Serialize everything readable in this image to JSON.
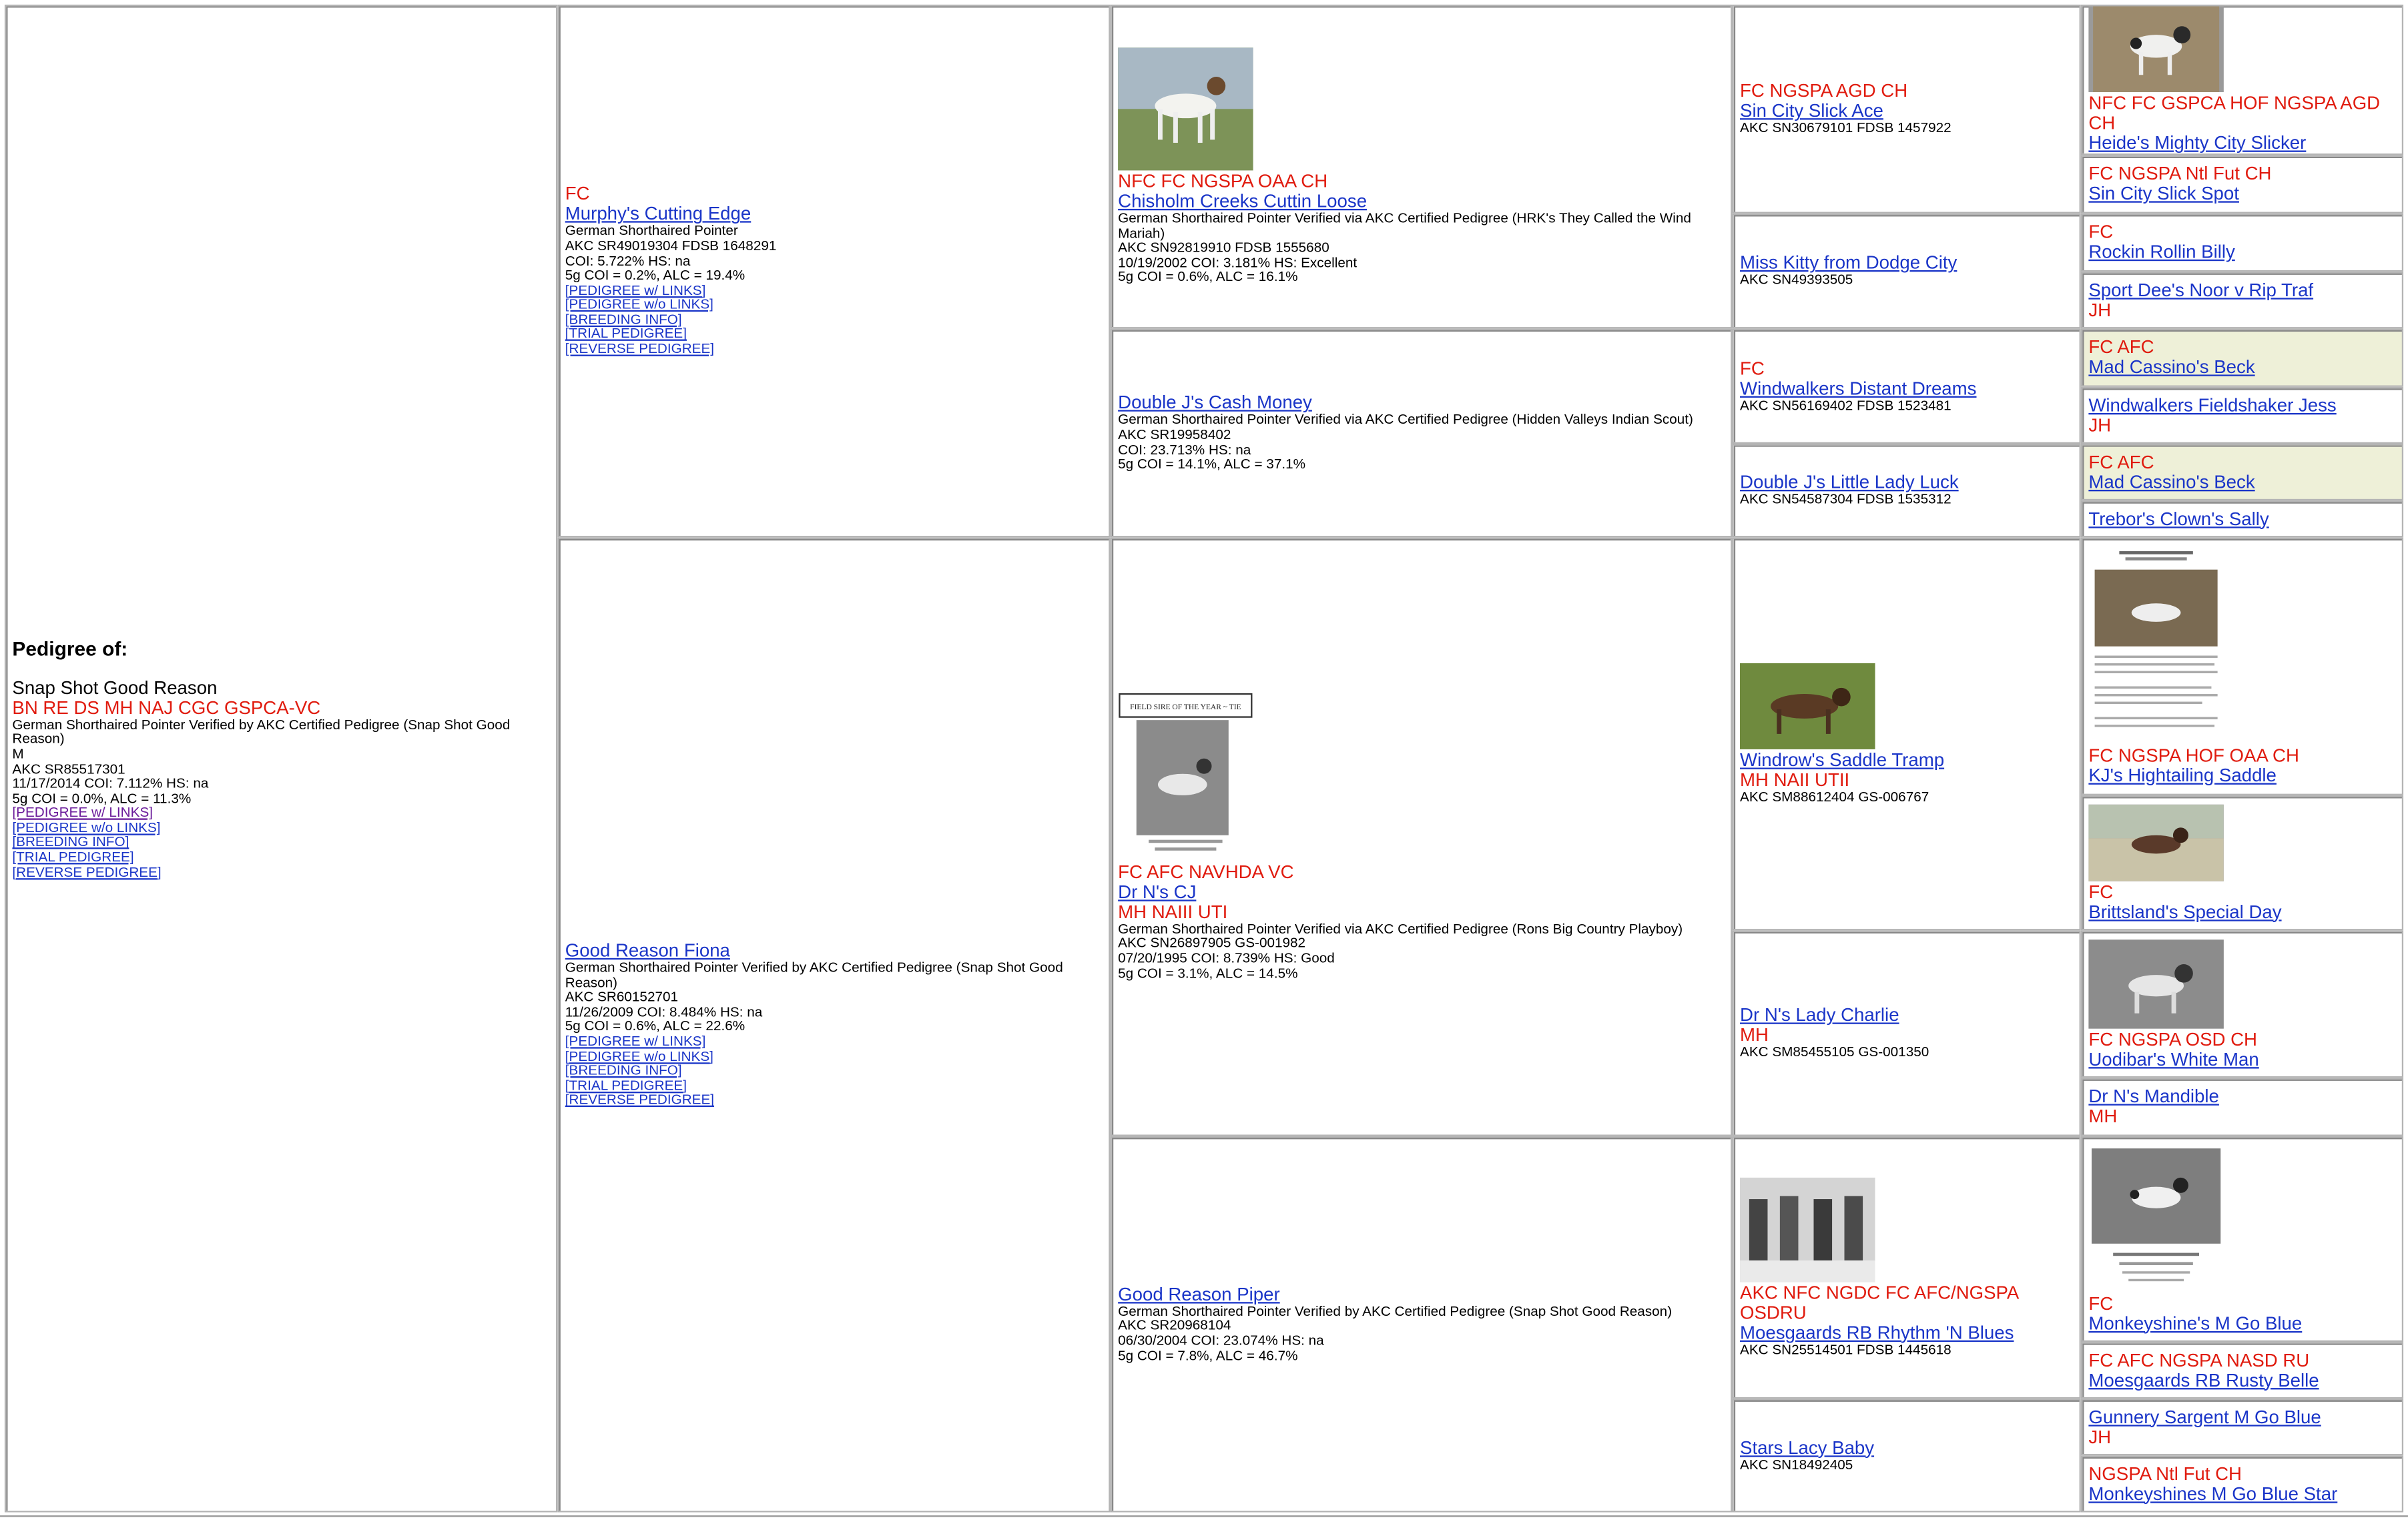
{
  "subject": {
    "heading": "Pedigree of:",
    "name": "Snap Shot Good Reason",
    "titles": "BN RE DS MH NAJ CGC GSPCA-VC",
    "breed": "German Shorthaired Pointer Verified by AKC Certified Pedigree (Snap Shot Good Reason)",
    "sex": "M",
    "reg": "AKC SR85517301",
    "dob_coi": "11/17/2014 COI: 7.112% HS: na",
    "coi5": "5g COI = 0.0%, ALC = 11.3%",
    "links": [
      "[PEDIGREE w/ LINKS]",
      "[PEDIGREE w/o LINKS]",
      "[BREEDING INFO]",
      "[TRIAL PEDIGREE]",
      "[REVERSE PEDIGREE]"
    ]
  },
  "gen1": {
    "sire": {
      "title": "FC",
      "name": "Murphy's Cutting Edge",
      "breed": "German Shorthaired Pointer",
      "reg": "AKC SR49019304 FDSB 1648291",
      "coi": "COI: 5.722% HS: na",
      "coi5": "5g COI = 0.2%, ALC = 19.4%",
      "links": [
        "[PEDIGREE w/ LINKS]",
        "[PEDIGREE w/o LINKS]",
        "[BREEDING INFO]",
        "[TRIAL PEDIGREE]",
        "[REVERSE PEDIGREE]"
      ]
    },
    "dam": {
      "name": "Good Reason Fiona",
      "breed": "German Shorthaired Pointer Verified by AKC Certified Pedigree (Snap Shot Good Reason)",
      "reg": "AKC SR60152701",
      "coi": "11/26/2009 COI: 8.484% HS: na",
      "coi5": "5g COI = 0.6%, ALC = 22.6%",
      "links": [
        "[PEDIGREE w/ LINKS]",
        "[PEDIGREE w/o LINKS]",
        "[BREEDING INFO]",
        "[TRIAL PEDIGREE]",
        "[REVERSE PEDIGREE]"
      ]
    }
  },
  "gen2": [
    {
      "title": "NFC FC NGSPA OAA CH",
      "name": "Chisholm Creeks Cuttin Loose",
      "breed": "German Shorthaired Pointer Verified via AKC Certified Pedigree (HRK's They Called the Wind Mariah)",
      "reg": "AKC SN92819910 FDSB 1555680",
      "coi": "10/19/2002 COI: 3.181% HS: Excellent",
      "coi5": "5g COI = 0.6%, ALC = 16.1%"
    },
    {
      "name": "Double J's Cash Money",
      "breed": "German Shorthaired Pointer Verified via AKC Certified Pedigree (Hidden Valleys Indian Scout)",
      "reg": "AKC SR19958402",
      "coi": "COI: 23.713% HS: na",
      "coi5": "5g COI = 14.1%, ALC = 37.1%"
    },
    {
      "title": "FC AFC NAVHDA VC",
      "name": "Dr N's CJ",
      "suffix": "MH NAIII UTI",
      "breed": "German Shorthaired Pointer Verified via AKC Certified Pedigree (Rons Big Country Playboy)",
      "reg": "AKC SN26897905 GS-001982",
      "coi": "07/20/1995 COI: 8.739% HS: Good",
      "coi5": "5g COI = 3.1%, ALC = 14.5%",
      "photo_caption": "FIELD SIRE OF THE YEAR ~ TIE"
    },
    {
      "name": "Good Reason Piper",
      "breed": "German Shorthaired Pointer Verified by AKC Certified Pedigree (Snap Shot Good Reason)",
      "reg": "AKC SR20968104",
      "coi": "06/30/2004 COI: 23.074% HS: na",
      "coi5": "5g COI = 7.8%, ALC = 46.7%"
    }
  ],
  "gen3": [
    {
      "title": "FC NGSPA AGD CH",
      "name": "Sin City Slick Ace",
      "reg": "AKC SN30679101 FDSB 1457922"
    },
    {
      "name": "Miss Kitty from Dodge City",
      "reg": "AKC SN49393505"
    },
    {
      "title": "FC",
      "name": "Windwalkers Distant Dreams",
      "reg": "AKC SN56169402 FDSB 1523481"
    },
    {
      "name": "Double J's Little Lady Luck",
      "reg": "AKC SN54587304 FDSB 1535312"
    },
    {
      "name": "Windrow's Saddle Tramp",
      "suffix": "MH NAII UTII",
      "reg": "AKC SM88612404 GS-006767"
    },
    {
      "name": "Dr N's Lady Charlie",
      "suffix": "MH",
      "reg": "AKC SM85455105 GS-001350"
    },
    {
      "title": "AKC NFC NGDC FC AFC/NGSPA OSDRU",
      "name": "Moesgaards RB Rhythm 'N Blues",
      "reg": "AKC SN25514501 FDSB 1445618"
    },
    {
      "name": "Stars Lacy Baby",
      "reg": "AKC SN18492405"
    }
  ],
  "gen4": [
    {
      "title": "NFC FC GSPCA HOF NGSPA AGD CH",
      "name": "Heide's Mighty City Slicker"
    },
    {
      "title": "FC NGSPA Ntl Fut CH",
      "name": "Sin City Slick Spot"
    },
    {
      "title": "FC",
      "name": "Rockin Rollin Billy"
    },
    {
      "name": "Sport Dee's Noor v Rip Traf",
      "suffix": "JH"
    },
    {
      "title": "FC AFC",
      "name": "Mad Cassino's Beck"
    },
    {
      "name": "Windwalkers Fieldshaker Jess",
      "suffix": "JH"
    },
    {
      "title": "FC AFC",
      "name": "Mad Cassino's Beck"
    },
    {
      "name": "Trebor's Clown's Sally"
    },
    {
      "title": "FC NGSPA HOF OAA CH",
      "name": "KJ's Hightailing Saddle"
    },
    {
      "title": "FC",
      "name": "Brittsland's Special Day"
    },
    {
      "title": "FC NGSPA OSD CH",
      "name": "Uodibar's White Man"
    },
    {
      "name": "Dr N's Mandible",
      "suffix": "MH"
    },
    {
      "title": "FC",
      "name": "Monkeyshine's M Go Blue"
    },
    {
      "title": "FC AFC NGSPA NASD RU",
      "name": "Moesgaards RB Rusty Belle"
    },
    {
      "name": "Gunnery Sargent M Go Blue",
      "suffix": "JH"
    },
    {
      "title": "NGSPA Ntl Fut CH",
      "name": "Monkeyshines M Go Blue Star"
    }
  ],
  "colors": {
    "title_red": "#e01b0e",
    "link_blue": "#1a35c8",
    "visited_purple": "#6a1a9a",
    "highlight": "#eef0d8"
  }
}
